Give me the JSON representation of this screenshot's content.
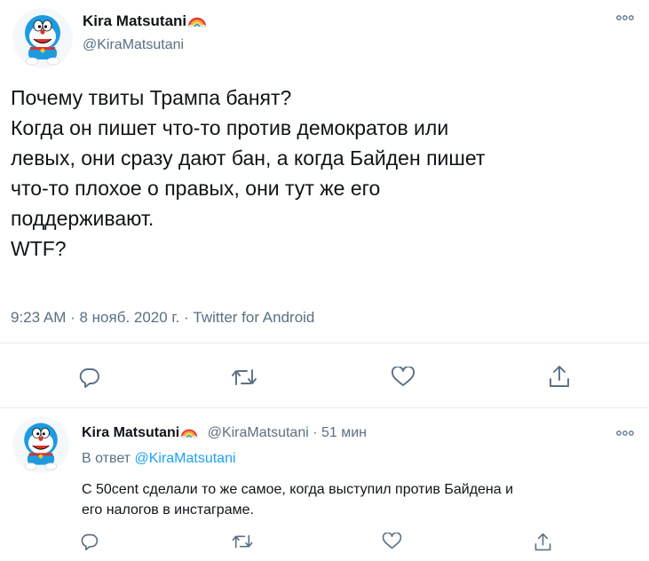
{
  "colors": {
    "accent": "#1da1f2",
    "secondary_text": "#5b7083",
    "divider": "#e6ecf0"
  },
  "main_tweet": {
    "author_name": "Kira Matsutani",
    "author_emoji": "rainbow",
    "author_handle": "@KiraMatsutani",
    "text": "Почему твиты Трампа банят?\nКогда он пишет что-то против демократов или\nлевых, они сразу дают бан, а когда Байден пишет\nчто-то плохое о правых, они тут же его\nподдерживают.\nWTF?",
    "timestamp": "9:23 AM · 8 нояб. 2020 г. · Twitter for Android",
    "actions": [
      "reply-icon",
      "retweet-icon",
      "like-icon",
      "share-icon"
    ]
  },
  "reply_tweet": {
    "author_name": "Kira Matsutani",
    "author_emoji": "rainbow",
    "author_handle": "@KiraMatsutani",
    "time_ago": "51 мин",
    "reply_to_prefix": "В ответ",
    "reply_to_handle": "@KiraMatsutani",
    "text": "С 50cent сделали то же самое, когда выступил против Байдена и\nего налогов в инстаграме.",
    "actions": [
      "reply-icon",
      "retweet-icon",
      "like-icon",
      "share-icon"
    ]
  }
}
